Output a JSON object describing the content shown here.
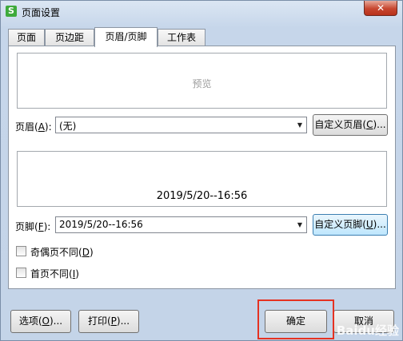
{
  "window": {
    "title": "页面设置",
    "app_icon_letter": "S",
    "close_glyph": "✕"
  },
  "tabs": [
    {
      "label": "页面",
      "active": false
    },
    {
      "label": "页边距",
      "active": false
    },
    {
      "label": "页眉/页脚",
      "active": true
    },
    {
      "label": "工作表",
      "active": false
    }
  ],
  "header_preview": {
    "text": "预览"
  },
  "header": {
    "label_prefix": "页眉(",
    "label_key": "A",
    "label_suffix": "):",
    "selected": "(无)",
    "custom_button_prefix": "自定义页眉(",
    "custom_button_key": "C",
    "custom_button_suffix": ")..."
  },
  "footer_preview": {
    "text": "2019/5/20--16:56"
  },
  "footer": {
    "label_prefix": "页脚(",
    "label_key": "F",
    "label_suffix": "):",
    "selected": "2019/5/20--16:56",
    "custom_button_prefix": "自定义页脚(",
    "custom_button_key": "U",
    "custom_button_suffix": ")..."
  },
  "options": {
    "odd_even_prefix": "奇偶页不同(",
    "odd_even_key": "D",
    "odd_even_suffix": ")",
    "odd_even_checked": false,
    "first_page_prefix": "首页不同(",
    "first_page_key": "I",
    "first_page_suffix": ")",
    "first_page_checked": false
  },
  "buttons": {
    "options_prefix": "选项(",
    "options_key": "O",
    "options_suffix": ")...",
    "print_prefix": "打印(",
    "print_key": "P",
    "print_suffix": ")...",
    "ok": "确定",
    "cancel": "取消"
  },
  "watermark": "Baidu经验"
}
